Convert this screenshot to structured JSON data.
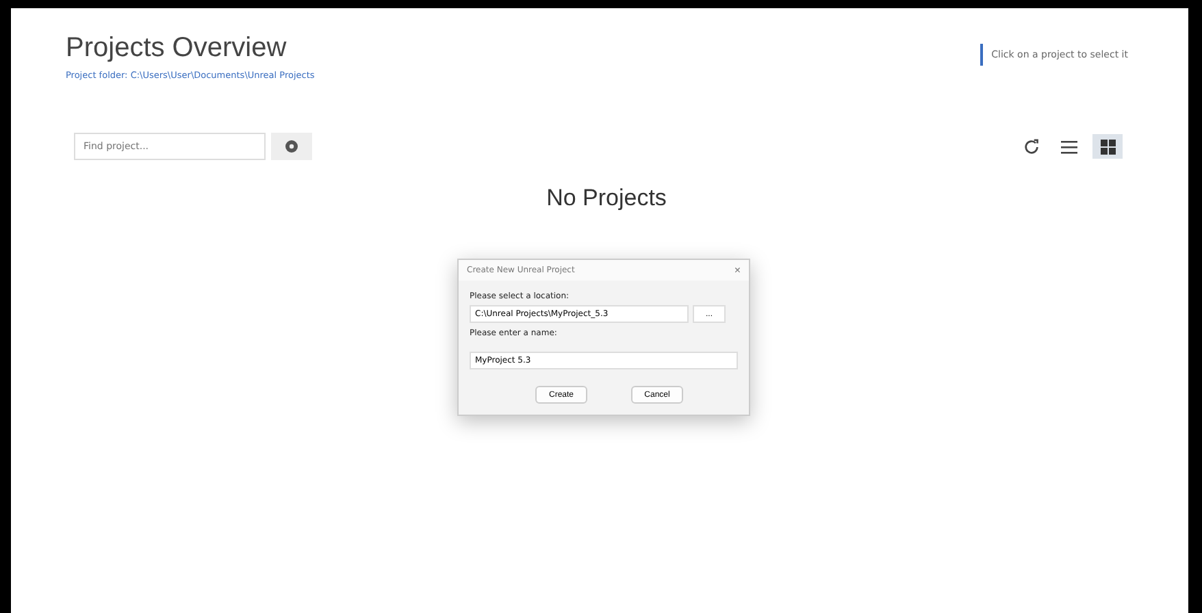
{
  "header": {
    "title": "Projects Overview",
    "folder_link": "Project folder: C:\\Users\\User\\Documents\\Unreal Projects",
    "hint": "Click on a project to select it"
  },
  "toolbar": {
    "search": {
      "placeholder": "Find project..."
    },
    "views": [
      {
        "kind": "refresh",
        "selected": false
      },
      {
        "kind": "list",
        "selected": false
      },
      {
        "kind": "grid",
        "selected": true
      }
    ]
  },
  "empty_message": "No Projects",
  "dialog": {
    "title": "Create New Unreal Project",
    "close": "×",
    "location_label": "Please select a location:",
    "location_value": "C:\\Unreal Projects\\MyProject_5.3",
    "browse": "...",
    "name_label": "Please enter a name:",
    "name_value": "MyProject 5.3",
    "buttons": [
      "Create",
      "Cancel"
    ]
  }
}
